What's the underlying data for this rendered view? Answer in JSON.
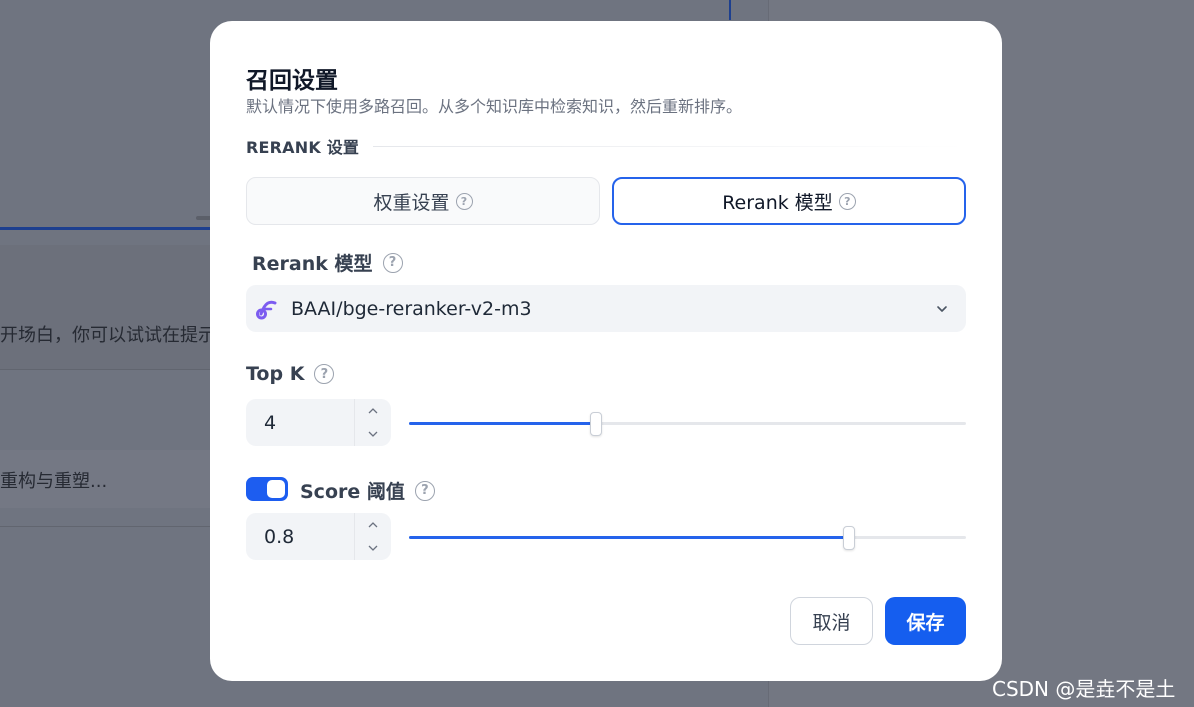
{
  "background": {
    "line1": "开场白，你可以试试在提示",
    "line2": "重构与重塑..."
  },
  "modal": {
    "title": "召回设置",
    "subtitle": "默认情况下使用多路召回。从多个知识库中检索知识，然后重新排序。",
    "section_label": "RERANK 设置",
    "modes": [
      {
        "label": "权重设置",
        "selected": false
      },
      {
        "label": "Rerank 模型",
        "selected": true
      }
    ],
    "rerank_model": {
      "label": "Rerank 模型",
      "icon": "model-provider-icon",
      "value": "BAAI/bge-reranker-v2-m3"
    },
    "top_k": {
      "label": "Top K",
      "value": "4",
      "slider_fraction": 0.335
    },
    "score_threshold": {
      "label": "Score 阈值",
      "enabled": true,
      "value": "0.8",
      "slider_fraction": 0.79
    },
    "buttons": {
      "cancel": "取消",
      "save": "保存"
    }
  },
  "help_glyph": "?",
  "watermark": "CSDN @是垚不是土",
  "colors": {
    "accent": "#155eef",
    "selected_border": "#2563eb",
    "overlay": "#6f737e"
  }
}
